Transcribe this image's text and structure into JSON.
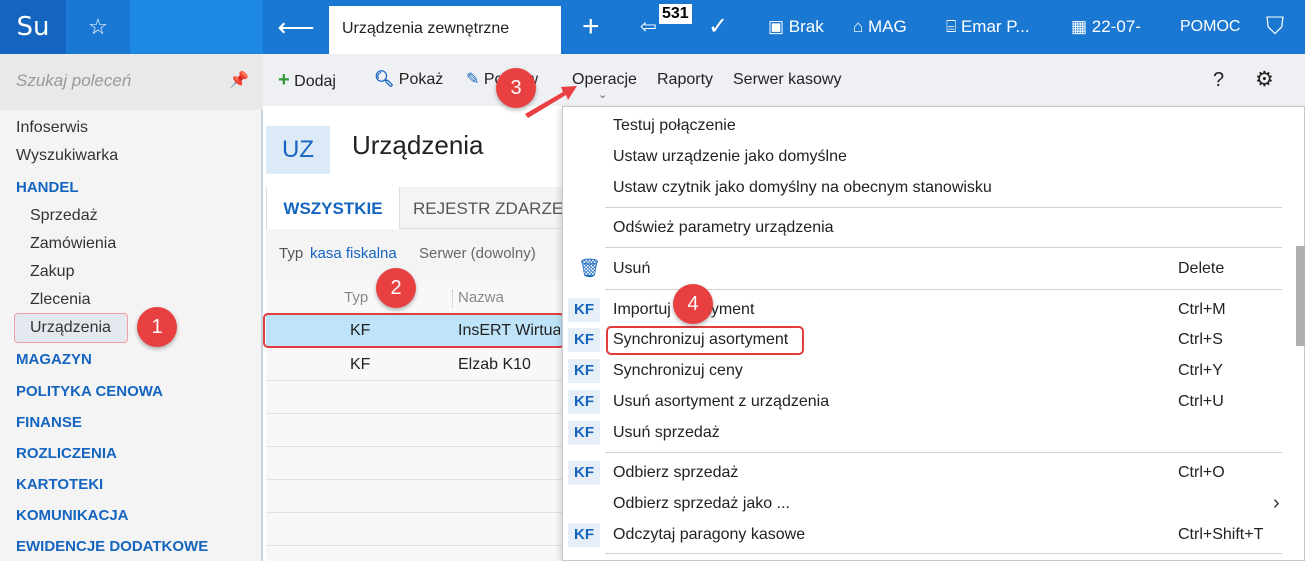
{
  "topbar": {
    "logo": "Su",
    "active_tab": "Urządzenia zewnętrzne",
    "badge": "531",
    "items": [
      "Brak",
      "MAG",
      "Emar P...",
      "22-07-",
      "POMOC"
    ]
  },
  "sidebar": {
    "search_placeholder": "Szukaj poleceń",
    "items": [
      "Infoserwis",
      "Wyszukiwarka"
    ],
    "handel": "HANDEL",
    "handel_items": [
      "Sprzedaż",
      "Zamówienia",
      "Zakup",
      "Zlecenia",
      "Urządzenia"
    ],
    "groups": [
      "MAGAZYN",
      "POLITYKA CENOWA",
      "FINANSE",
      "ROZLICZENIA",
      "KARTOTEKI",
      "KOMUNIKACJA",
      "EWIDENCJE DODATKOWE"
    ]
  },
  "toolbar": {
    "dodaj": "Dodaj",
    "pokaz": "Pokaż",
    "popraw": "Popraw",
    "operacje": "Operacje",
    "raporty": "Raporty",
    "serwer": "Serwer kasowy",
    "help": "?"
  },
  "page": {
    "badge": "UZ",
    "title": "Urządzenia",
    "tab_all": "WSZYSTKIE",
    "tab_rejestr": "REJESTR ZDARZEŃ",
    "filter_typ_label": "Typ",
    "filter_typ_value": "kasa fiskalna",
    "filter_serwer": "Serwer (dowolny)",
    "col_typ": "Typ",
    "col_nazwa": "Nazwa",
    "rows": [
      {
        "typ": "KF",
        "nazwa": "InsERT Wirtualna"
      },
      {
        "typ": "KF",
        "nazwa": "Elzab K10"
      }
    ]
  },
  "menu": {
    "items": [
      {
        "label": "Testuj połączenie",
        "shortcut": ""
      },
      {
        "label": "Ustaw urządzenie jako domyślne",
        "shortcut": ""
      },
      {
        "label": "Ustaw czytnik jako domyślny na obecnym stanowisku",
        "shortcut": ""
      },
      {
        "label": "Odśwież parametry urządzenia",
        "shortcut": ""
      },
      {
        "label": "Usuń",
        "shortcut": "Delete"
      },
      {
        "label": "Importuj asortyment",
        "shortcut": "Ctrl+M"
      },
      {
        "label": "Synchronizuj asortyment",
        "shortcut": "Ctrl+S"
      },
      {
        "label": "Synchronizuj ceny",
        "shortcut": "Ctrl+Y"
      },
      {
        "label": "Usuń asortyment z urządzenia",
        "shortcut": "Ctrl+U"
      },
      {
        "label": "Usuń sprzedaż",
        "shortcut": ""
      },
      {
        "label": "Odbierz sprzedaż",
        "shortcut": "Ctrl+O"
      },
      {
        "label": "Odbierz sprzedaż jako ...",
        "shortcut": ""
      },
      {
        "label": "Odczytaj paragony kasowe",
        "shortcut": "Ctrl+Shift+T"
      }
    ],
    "kf": "KF",
    "submenu_arrow": "›"
  },
  "annotations": [
    "1",
    "2",
    "3",
    "4"
  ],
  "colors": {
    "topbar": "#1a78d2",
    "accent": "#1565c0",
    "annotation": "#e84040"
  }
}
